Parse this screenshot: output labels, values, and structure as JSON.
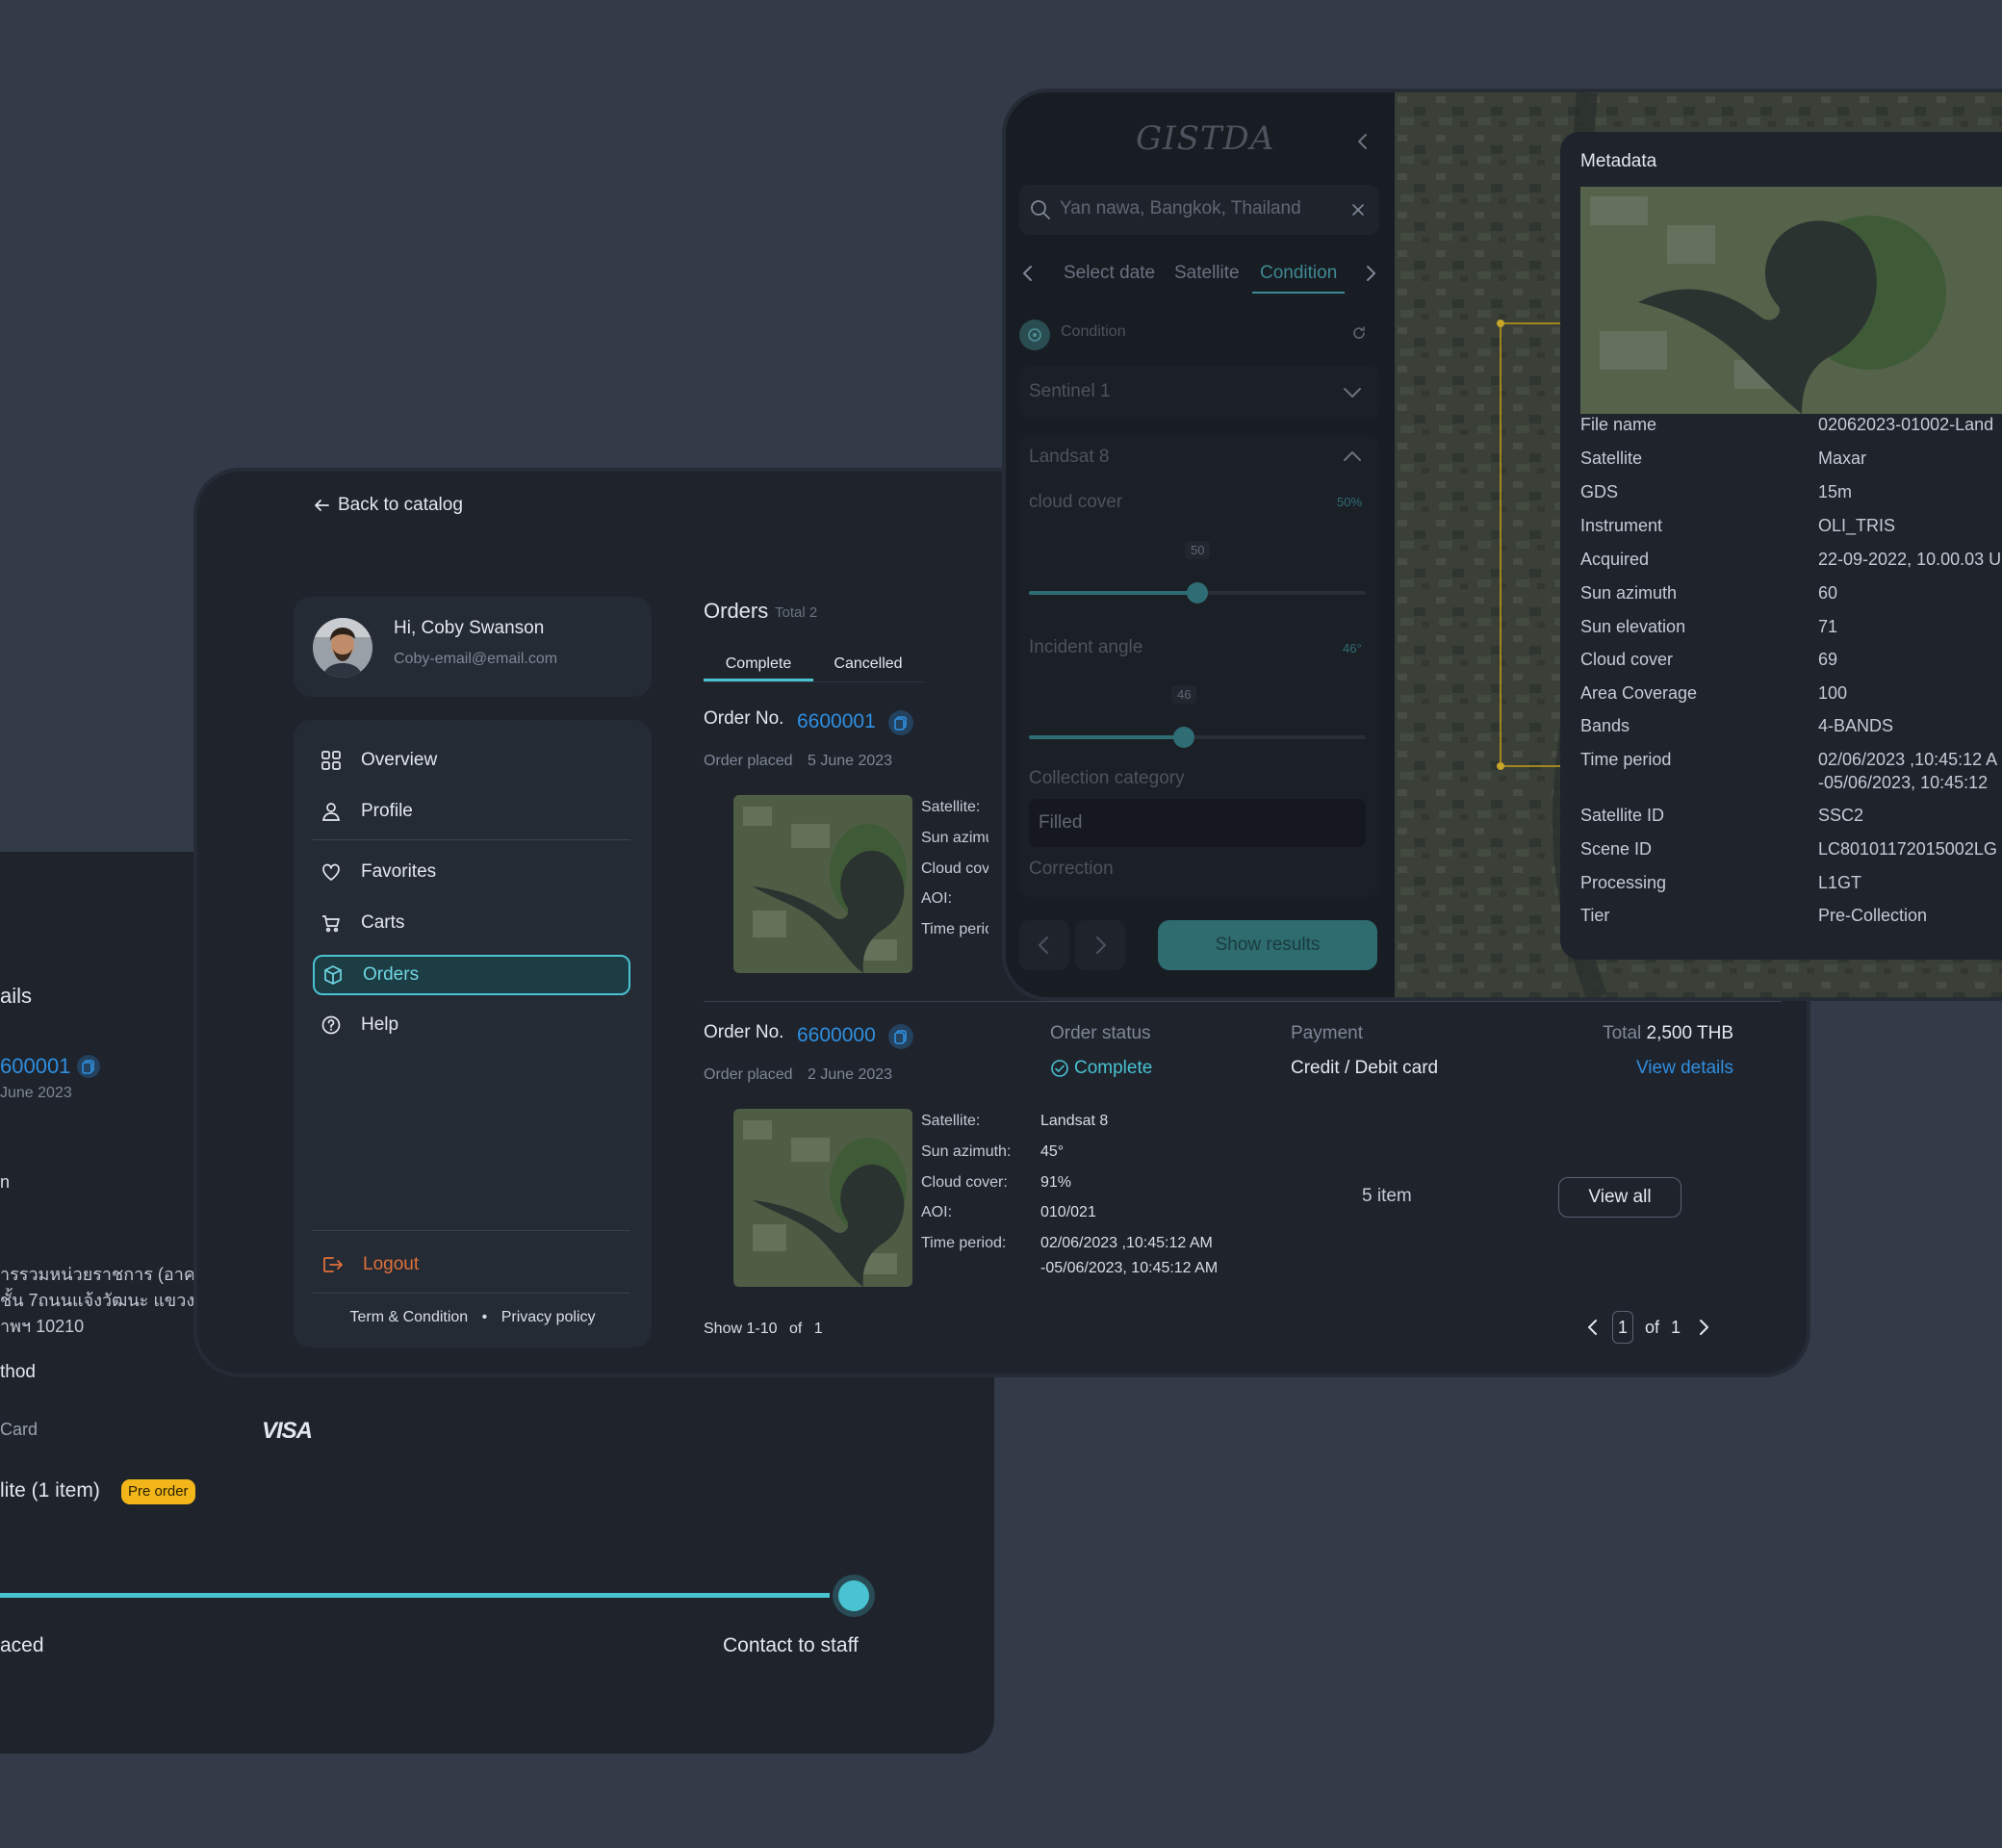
{
  "back": {
    "title_fragment": "ails",
    "order_fragment": "600001",
    "date_fragment": "June 2023",
    "n_fragment": "n",
    "address_line1": "ารรวมหน่วยราชการ (อาคารร",
    "address_line2": "ชั้น 7ถนนแจ้งวัฒนะ แขวงทุ่ง",
    "address_line3": "าพฯ 10210",
    "method_fragment": "thod",
    "card_fragment": "Card",
    "visa": "VISA",
    "item_fragment": "lite (1 item)",
    "preorder_badge": "Pre order",
    "placed_fragment": "aced",
    "contact_staff": "Contact to staff",
    "progress": 1.0
  },
  "orders": {
    "back_link": "Back to catalog",
    "user": {
      "greeting": "Hi, Coby Swanson",
      "email": "Coby-email@email.com"
    },
    "nav": {
      "overview": "Overview",
      "profile": "Profile",
      "favorites": "Favorites",
      "carts": "Carts",
      "orders": "Orders",
      "help": "Help",
      "logout": "Logout"
    },
    "footer": {
      "terms": "Term & Condition",
      "dot": "•",
      "privacy": "Privacy policy"
    },
    "title": "Orders",
    "total_label": "Total 2",
    "tabs": {
      "complete": "Complete",
      "cancelled": "Cancelled"
    },
    "order_no_label": "Order No.",
    "order_placed_label": "Order placed",
    "order1": {
      "number": "6600001",
      "date": "5 June 2023",
      "labels": [
        "Satellite:",
        "Sun azimuth:",
        "Cloud cover:",
        "AOI:",
        "Time period:"
      ]
    },
    "order2": {
      "number": "6600000",
      "date": "2 June 2023",
      "status_label": "Order status",
      "status": "Complete",
      "payment_label": "Payment",
      "payment": "Credit / Debit card",
      "total_label": "Total",
      "total": "2,500 THB",
      "view_details": "View details",
      "labels": [
        "Satellite:",
        "Sun azimuth:",
        "Cloud cover:",
        "AOI:",
        "Time period:"
      ],
      "values": [
        "Landsat 8",
        "45°",
        "91%",
        "010/021",
        "02/06/2023 ,10:45:12 AM",
        "-05/06/2023, 10:45:12 AM"
      ],
      "items": "5 item",
      "view_all": "View all"
    },
    "pagination": {
      "show": "Show 1-10",
      "of_label": "of",
      "of_total": "1",
      "page": "1",
      "page_of": "of",
      "page_total": "1"
    }
  },
  "filter": {
    "logo": "GISTDA",
    "search_value": "Yan nawa, Bangkok, Thailand",
    "tabs": {
      "select_date": "Select date",
      "satellite": "Satellite",
      "condition": "Condition"
    },
    "condition_label": "Condition",
    "sentinel": "Sentinel 1",
    "landsat": "Landsat 8",
    "cloud_cover_label": "cloud cover",
    "cloud_cover_pct": "50%",
    "cloud_cover_value": "50",
    "cloud_cover_level": 0.5,
    "incident_label": "Incident angle",
    "incident_deg": "46°",
    "incident_value": "46",
    "incident_level": 0.46,
    "collection_label": "Collection category",
    "collection_value": "Filled",
    "correction_label": "Correction",
    "show_results": "Show results"
  },
  "metadata": {
    "title": "Metadata",
    "rows": [
      {
        "k": "File name",
        "v": "02062023-01002-Land"
      },
      {
        "k": "Satellite",
        "v": "Maxar"
      },
      {
        "k": "GDS",
        "v": "15m"
      },
      {
        "k": "Instrument",
        "v": "OLI_TRIS"
      },
      {
        "k": "Acquired",
        "v": "22-09-2022, 10.00.03 U"
      },
      {
        "k": "Sun azimuth",
        "v": "60"
      },
      {
        "k": "Sun elevation",
        "v": "71"
      },
      {
        "k": "Cloud cover",
        "v": "69"
      },
      {
        "k": "Area Coverage",
        "v": "100"
      },
      {
        "k": "Bands",
        "v": "4-BANDS"
      },
      {
        "k": "Time period",
        "v": "02/06/2023 ,10:45:12 A",
        "v2": "-05/06/2023, 10:45:12"
      },
      {
        "k": "Satellite ID",
        "v": "SSC2"
      },
      {
        "k": "Scene ID",
        "v": "LC80101172015002LG"
      },
      {
        "k": "Processing",
        "v": "L1GT"
      },
      {
        "k": "Tier",
        "v": "Pre-Collection"
      }
    ]
  },
  "colors": {
    "accent": "#49c2d1",
    "link": "#2f8fe0",
    "logout": "#e0703a",
    "badge": "#f2b61b",
    "bg": "#343b48",
    "panel": "#1e232c"
  }
}
